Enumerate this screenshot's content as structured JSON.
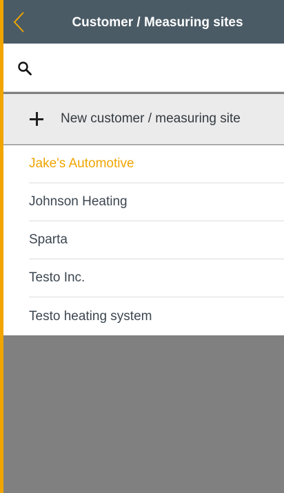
{
  "header": {
    "title": "Customer / Measuring sites",
    "back_icon": "chevron-left-icon"
  },
  "search": {
    "placeholder": "",
    "value": "",
    "icon": "search-icon"
  },
  "new_item": {
    "label": "New customer / measuring site",
    "icon": "plus-icon"
  },
  "list": {
    "items": [
      {
        "label": "Jake's Automotive",
        "selected": true
      },
      {
        "label": "Johnson Heating",
        "selected": false
      },
      {
        "label": "Sparta",
        "selected": false
      },
      {
        "label": "Testo Inc.",
        "selected": false
      },
      {
        "label": "Testo heating system",
        "selected": false
      }
    ]
  },
  "colors": {
    "accent": "#f0a500",
    "header_bg": "#4a5b66",
    "overlay": "#808080"
  }
}
